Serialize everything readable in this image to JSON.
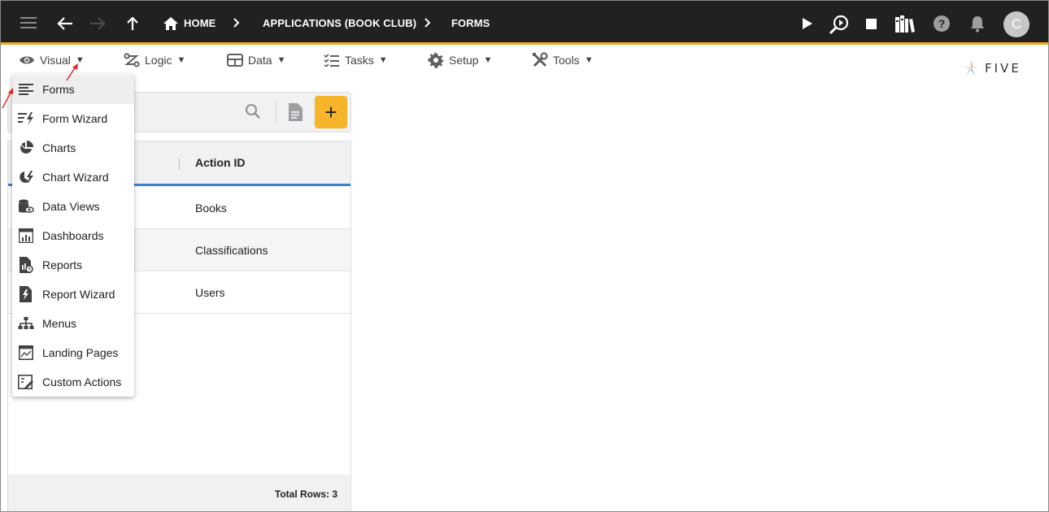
{
  "topbar": {
    "breadcrumbs": [
      "HOME",
      "APPLICATIONS (BOOK CLUB)",
      "FORMS"
    ],
    "user_initial": "C",
    "accent_color": "#f2a81d"
  },
  "menubar": {
    "items": [
      {
        "label": "Visual",
        "icon": "eye-icon"
      },
      {
        "label": "Logic",
        "icon": "flow-icon"
      },
      {
        "label": "Data",
        "icon": "table-icon"
      },
      {
        "label": "Tasks",
        "icon": "checklist-icon"
      },
      {
        "label": "Setup",
        "icon": "gear-icon"
      },
      {
        "label": "Tools",
        "icon": "tools-icon"
      }
    ],
    "caret": "▼"
  },
  "logo": {
    "text": "FIVE"
  },
  "list": {
    "add_label": "+",
    "column_header": "Action ID",
    "rows": [
      "Books",
      "Classifications",
      "Users"
    ],
    "footer": "Total Rows: 3"
  },
  "dropdown": {
    "items": [
      {
        "label": "Forms",
        "icon": "forms-icon"
      },
      {
        "label": "Form Wizard",
        "icon": "form-wizard-icon"
      },
      {
        "label": "Charts",
        "icon": "pie-chart-icon"
      },
      {
        "label": "Chart Wizard",
        "icon": "chart-wizard-icon"
      },
      {
        "label": "Data Views",
        "icon": "database-eye-icon"
      },
      {
        "label": "Dashboards",
        "icon": "dashboard-icon"
      },
      {
        "label": "Reports",
        "icon": "report-icon"
      },
      {
        "label": "Report Wizard",
        "icon": "report-wizard-icon"
      },
      {
        "label": "Menus",
        "icon": "sitemap-icon"
      },
      {
        "label": "Landing Pages",
        "icon": "landing-page-icon"
      },
      {
        "label": "Custom Actions",
        "icon": "custom-action-icon"
      }
    ]
  }
}
